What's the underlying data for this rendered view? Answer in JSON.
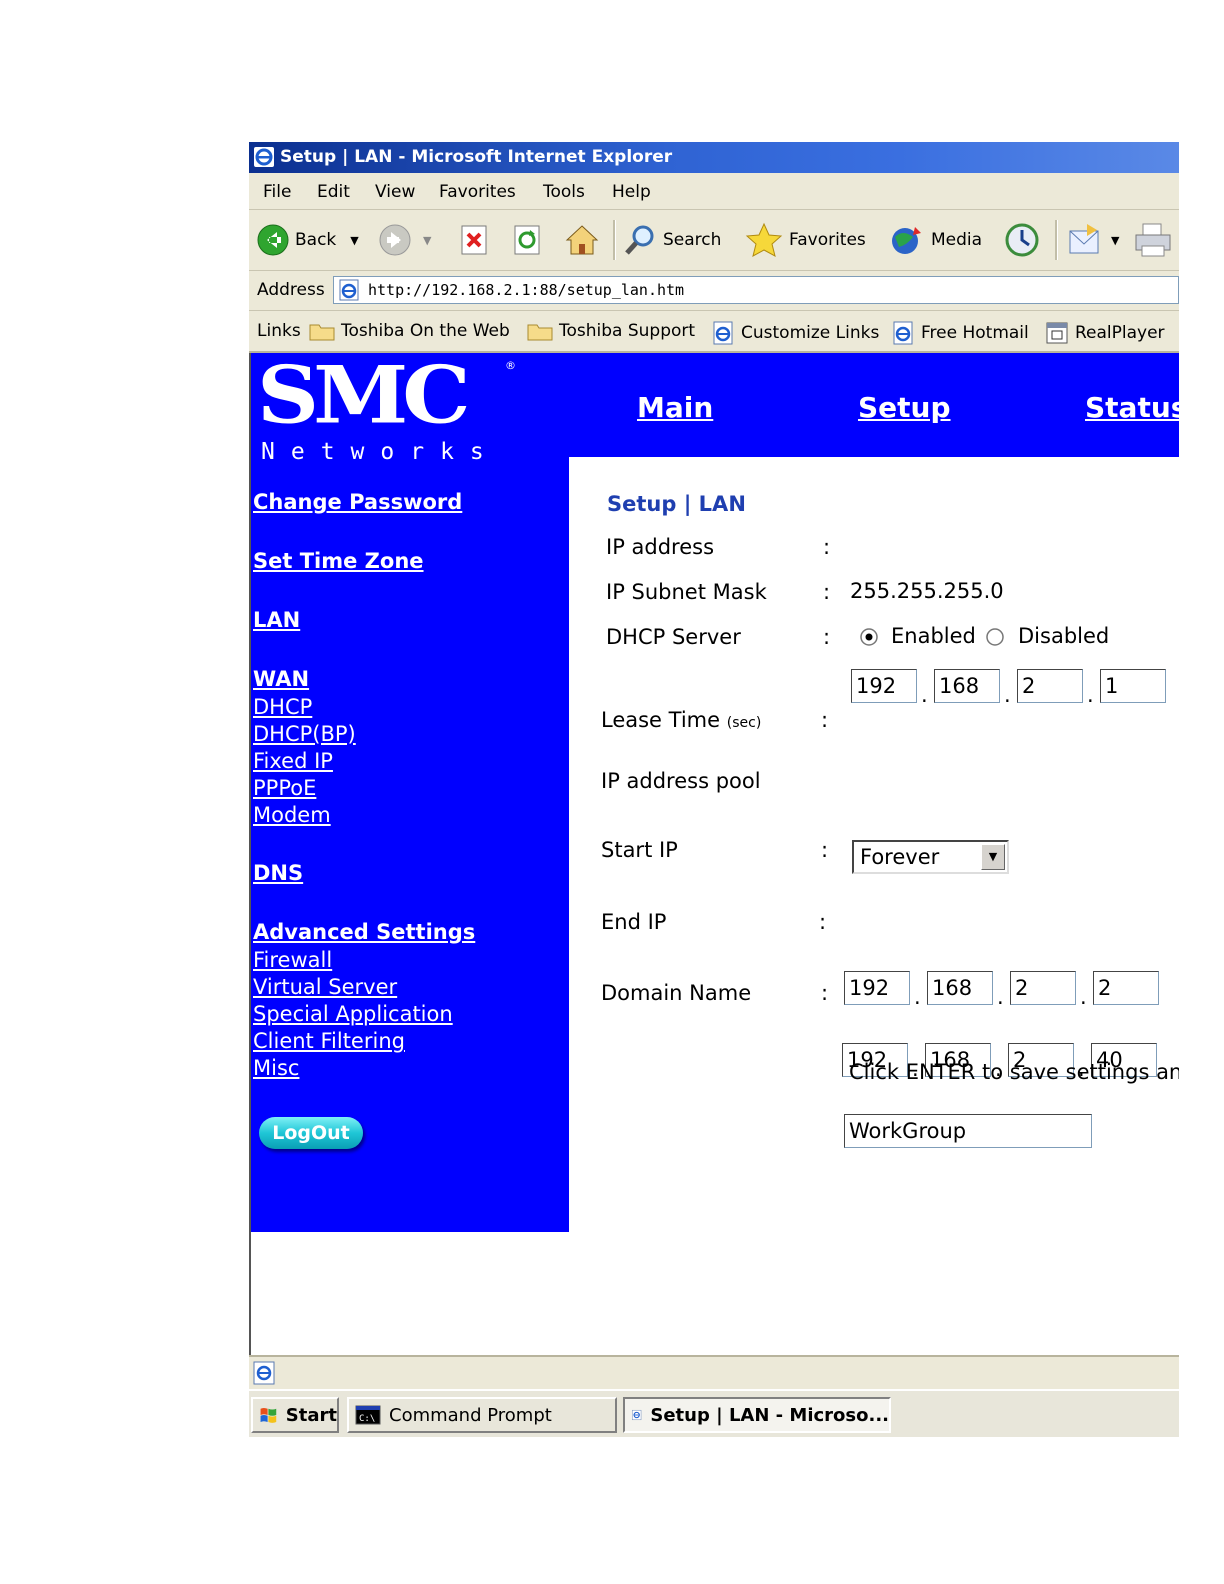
{
  "window": {
    "title": "Setup | LAN - Microsoft Internet Explorer"
  },
  "menu": [
    "File",
    "Edit",
    "View",
    "Favorites",
    "Tools",
    "Help"
  ],
  "toolbar": {
    "back": "Back",
    "search": "Search",
    "favorites": "Favorites",
    "media": "Media"
  },
  "address": {
    "label": "Address",
    "url": "http://192.168.2.1:88/setup_lan.htm"
  },
  "links": {
    "label": "Links",
    "items": [
      "Toshiba On the Web",
      "Toshiba Support",
      "Customize Links",
      "Free Hotmail",
      "RealPlayer"
    ]
  },
  "logo": {
    "brand": "SMC",
    "sub": "Networks"
  },
  "topnav": [
    "Main",
    "Setup",
    "Status"
  ],
  "sidebar": {
    "change_password": "Change  Password",
    "set_time_zone": "Set Time Zone",
    "lan": "LAN",
    "wan": "WAN",
    "wan_items": [
      "DHCP",
      "DHCP(BP)",
      "Fixed IP",
      "PPPoE",
      "Modem"
    ],
    "dns": "DNS",
    "advanced": "Advanced Settings",
    "advanced_items": [
      "Firewall",
      "Virtual Server",
      "Special Application",
      "Client Filtering",
      "Misc"
    ],
    "logout": "LogOut"
  },
  "form": {
    "heading": "Setup | LAN",
    "ip_label": "IP address",
    "ip": [
      "192",
      "168",
      "2",
      "1"
    ],
    "subnet_label": "IP Subnet Mask",
    "subnet_value": "255.255.255.0",
    "dhcp_label": "DHCP Server",
    "enabled": "Enabled",
    "disabled": "Disabled",
    "dhcp_enabled": true,
    "lease_label": "Lease Time",
    "lease_unit": "(sec)",
    "lease_value": "Forever",
    "pool_label": "IP address pool",
    "start_label": "Start IP",
    "start_ip": [
      "192",
      "168",
      "2",
      "2"
    ],
    "end_label": "End IP",
    "end_ip": [
      "192",
      "168",
      "2",
      "40"
    ],
    "domain_label": "Domain Name",
    "domain_value": "WorkGroup",
    "colon": ":",
    "dot": ".",
    "footer": "Click ENTER to save settings and"
  },
  "taskbar": {
    "start": "Start",
    "tasks": [
      "Command Prompt",
      "Setup | LAN - Microso..."
    ]
  }
}
